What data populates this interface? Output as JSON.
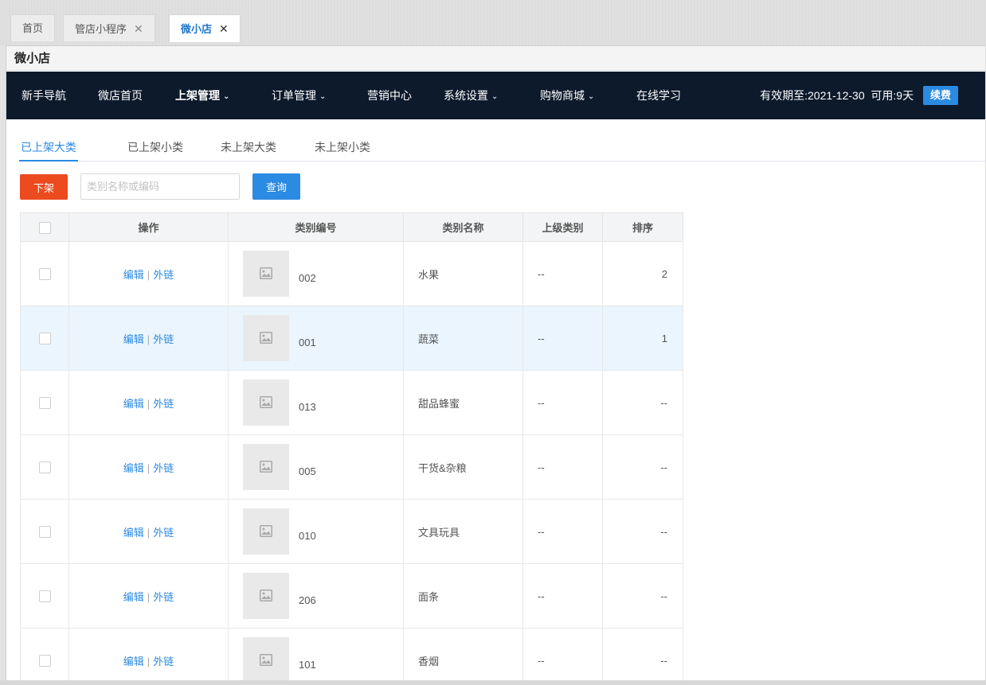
{
  "top_tabs": [
    {
      "label": "首页",
      "closable": false,
      "active": false
    },
    {
      "label": "管店小程序",
      "closable": true,
      "active": false
    },
    {
      "label": "微小店",
      "closable": true,
      "active": true
    }
  ],
  "close_glyph": "✕",
  "panel_title": "微小店",
  "nav": {
    "items": [
      {
        "label": "新手导航",
        "dropdown": false
      },
      {
        "label": "微店首页",
        "dropdown": false
      },
      {
        "label": "上架管理",
        "dropdown": true
      },
      {
        "label": "订单管理",
        "dropdown": true
      },
      {
        "label": "营销中心",
        "dropdown": false
      },
      {
        "label": "系统设置",
        "dropdown": true
      },
      {
        "label": "购物商城",
        "dropdown": true
      },
      {
        "label": "在线学习",
        "dropdown": false
      }
    ],
    "caret": "⌄",
    "expire_text": "有效期至:2021-12-30",
    "available_text": "可用:9天",
    "renew_label": "续费"
  },
  "sub_tabs": [
    {
      "label": "已上架大类",
      "active": true
    },
    {
      "label": "已上架小类",
      "active": false
    },
    {
      "label": "未上架大类",
      "active": false
    },
    {
      "label": "未上架小类",
      "active": false
    }
  ],
  "toolbar": {
    "down_label": "下架",
    "search_placeholder": "类别名称或编码",
    "search_value": "",
    "query_label": "查询"
  },
  "table": {
    "headers": [
      "操作",
      "类别编号",
      "类别名称",
      "上级类别",
      "排序"
    ],
    "edit_label": "编辑",
    "link_label": "外链",
    "separator": "|",
    "rows": [
      {
        "code": "002",
        "name": "水果",
        "parent": "--",
        "sort": "2",
        "highlight": false
      },
      {
        "code": "001",
        "name": "蔬菜",
        "parent": "--",
        "sort": "1",
        "highlight": true
      },
      {
        "code": "013",
        "name": "甜品蜂蜜",
        "parent": "--",
        "sort": "--",
        "highlight": false
      },
      {
        "code": "005",
        "name": "干货&杂粮",
        "parent": "--",
        "sort": "--",
        "highlight": false
      },
      {
        "code": "010",
        "name": "文具玩具",
        "parent": "--",
        "sort": "--",
        "highlight": false
      },
      {
        "code": "206",
        "name": "面条",
        "parent": "--",
        "sort": "--",
        "highlight": false
      },
      {
        "code": "101",
        "name": "香烟",
        "parent": "--",
        "sort": "--",
        "highlight": false
      }
    ]
  },
  "colors": {
    "accent": "#2b8ae2",
    "danger": "#ec4a1f",
    "navbar": "#0c1a2c",
    "row_highlight": "#eaf5fd"
  },
  "icons": {
    "thumb": "image-placeholder-icon"
  }
}
